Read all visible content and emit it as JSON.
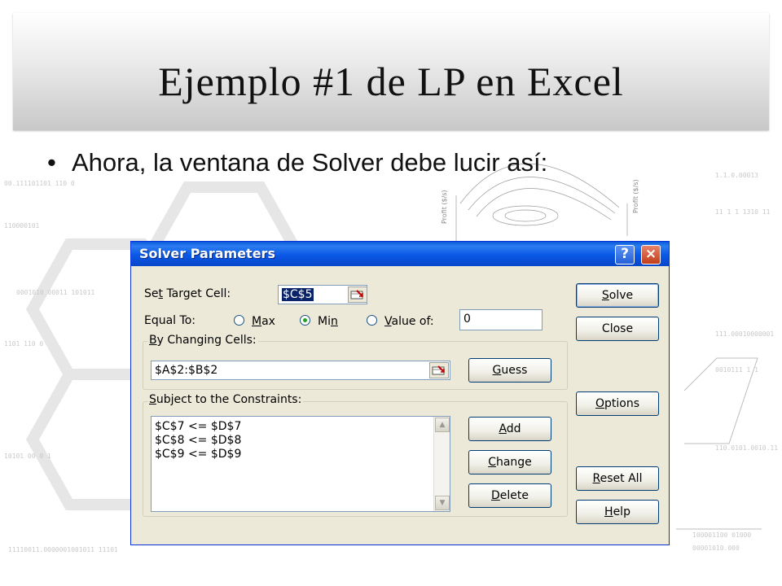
{
  "slide": {
    "title": "Ejemplo #1 de LP en Excel",
    "bullet_text": "Ahora, la ventana de Solver debe lucir así:"
  },
  "dialog": {
    "title": "Solver Parameters",
    "help_label": "?",
    "close_label": "×",
    "set_target_cell_label": {
      "pre": "Se",
      "u": "t",
      "post": " Target Cell:"
    },
    "target_cell_value": "$C$5",
    "equal_to_label": "Equal To:",
    "radio_max": {
      "pre": "",
      "u": "M",
      "post": "ax",
      "selected": false
    },
    "radio_min": {
      "pre": "Mi",
      "u": "n",
      "post": "",
      "selected": true
    },
    "radio_value_of": {
      "pre": "",
      "u": "V",
      "post": "alue of:",
      "selected": false
    },
    "value_of_input": "0",
    "changing_cells_title": {
      "pre": "",
      "u": "B",
      "post": "y Changing Cells:"
    },
    "changing_cells_value": "$A$2:$B$2",
    "constraints_title": {
      "pre": "",
      "u": "S",
      "post": "ubject to the Constraints:"
    },
    "constraints": [
      "$C$7 <= $D$7",
      "$C$8 <= $D$8",
      "$C$9 <= $D$9"
    ],
    "buttons": {
      "solve": {
        "pre": "",
        "u": "S",
        "post": "olve"
      },
      "close": {
        "pre": "",
        "u": "",
        "post": "Close"
      },
      "options": {
        "pre": "",
        "u": "O",
        "post": "ptions"
      },
      "reset_all": {
        "pre": "",
        "u": "R",
        "post": "eset All"
      },
      "help": {
        "pre": "",
        "u": "H",
        "post": "elp"
      },
      "guess": {
        "pre": "",
        "u": "G",
        "post": "uess"
      },
      "add": {
        "pre": "",
        "u": "A",
        "post": "dd"
      },
      "change": {
        "pre": "",
        "u": "C",
        "post": "hange"
      },
      "delete": {
        "pre": "",
        "u": "D",
        "post": "elete"
      }
    }
  },
  "colors": {
    "titlebar_blue": "#0a58e6",
    "dialog_face": "#ece9d8",
    "close_red": "#c13d18",
    "radio_dot": "#21a121"
  }
}
